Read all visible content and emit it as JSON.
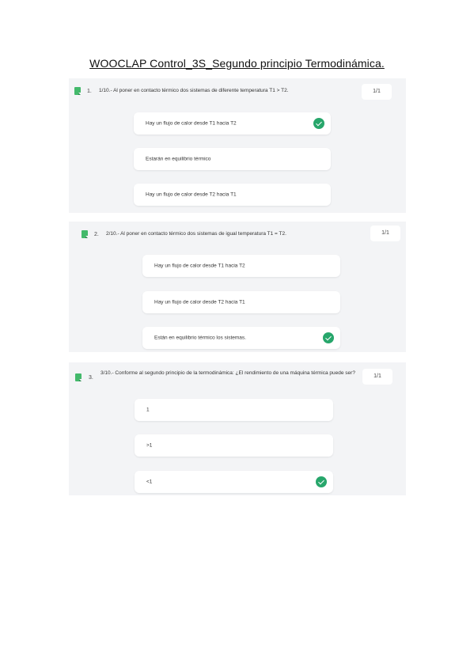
{
  "document": {
    "title": "WOOCLAP Control_3S_Segundo principio Termodinámica."
  },
  "questions": [
    {
      "number": "1.",
      "text": "1/10.- Al poner en contacto térmico dos sistemas de diferente temperatura T1 > T2.",
      "score": "1/1",
      "icon": "bookmark-icon",
      "options": [
        {
          "label": "Hay un flujo de calor desde T1 hacia T2",
          "correct": true
        },
        {
          "label": "Estarán en equilibrio térmico",
          "correct": false
        },
        {
          "label": "Hay un flujo de calor desde T2 hacia T1",
          "correct": false
        }
      ]
    },
    {
      "number": "2.",
      "text": "2/10.- Al poner en contacto térmico dos sistemas de igual temperatura T1 = T2.",
      "score": "1/1",
      "icon": "bookmark-icon",
      "options": [
        {
          "label": "Hay un flujo de calor desde T1 hacia T2",
          "correct": false
        },
        {
          "label": "Hay un flujo de calor desde T2 hacia T1",
          "correct": false
        },
        {
          "label": "Están en equilibrio térmico los sistemas.",
          "correct": true
        }
      ]
    },
    {
      "number": "3.",
      "text": "3/10.- Conforme al segundo principio de la termodinámica: ¿El rendimiento de una máquina térmica puede ser?",
      "score": "1/1",
      "icon": "bookmark-icon",
      "options": [
        {
          "label": "1",
          "correct": false
        },
        {
          "label": ">1",
          "correct": false
        },
        {
          "label": "<1",
          "correct": true
        }
      ]
    }
  ],
  "colors": {
    "panel": "#f3f4f6",
    "correct": "#27a66b",
    "icon": "#43b96b"
  }
}
